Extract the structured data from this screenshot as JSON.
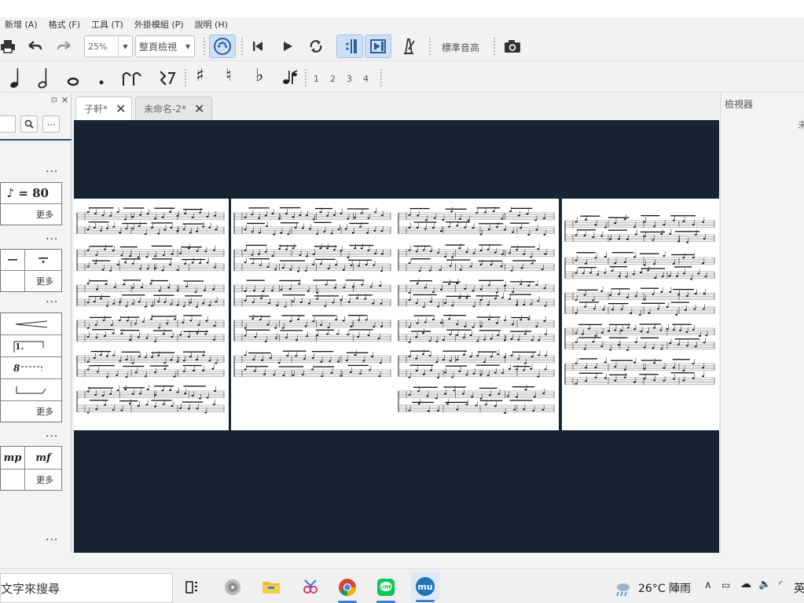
{
  "menu": [
    "新增 (A)",
    "格式 (F)",
    "工具 (T)",
    "外掛模組 (P)",
    "說明 (H)"
  ],
  "toolbar": {
    "zoom_value": "25%",
    "view_mode": "整頁檢視",
    "concert_pitch_label": "標準音高"
  },
  "note_input": {
    "voices": [
      "1",
      "2",
      "3",
      "4"
    ]
  },
  "palette": {
    "tempo_label": "♪ = 80",
    "more_label": "更多",
    "volta_label": "1.",
    "ottava_label": "8",
    "dynamic_mp": "mp",
    "dynamic_mf": "mf",
    "dots": "..."
  },
  "tabs": [
    {
      "label": "子軒*",
      "close": "✕"
    },
    {
      "label": "未命名-2*",
      "close": "✕"
    }
  ],
  "inspector": {
    "title": "檢視器",
    "clipped_text": "未"
  },
  "taskbar": {
    "search_placeholder": "文字來搜尋",
    "weather": "26°C  陣雨",
    "lang": "英"
  },
  "colors": {
    "canvas_bg": "#172433",
    "accent": "#3b82d6",
    "active_tool_bg": "#cde0f5"
  }
}
